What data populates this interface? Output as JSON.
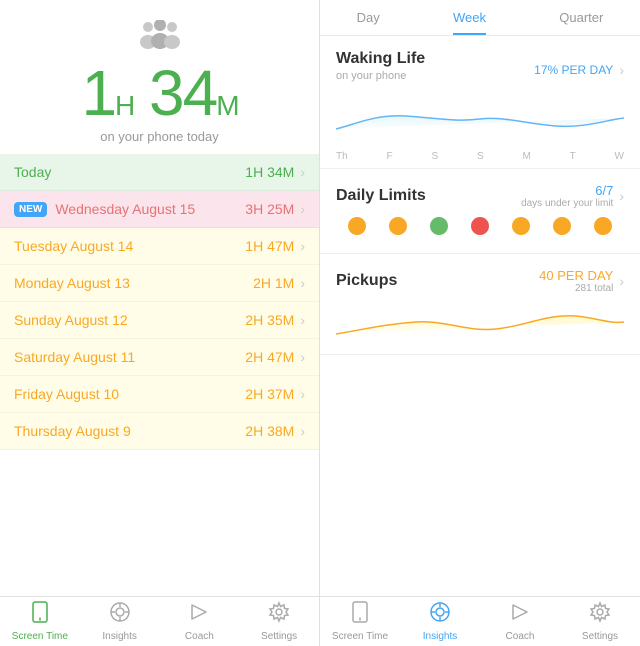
{
  "left": {
    "family_icon": "👨‍👩‍👧",
    "big_time": "1",
    "big_time_unit1": "H",
    "big_time2": "34",
    "big_time_unit2": "M",
    "subtitle": "on your phone today",
    "days": [
      {
        "label": "Today",
        "time": "1H 34M",
        "type": "today",
        "new": false
      },
      {
        "label": "Wednesday August 15",
        "time": "3H 25M",
        "type": "new",
        "new": true
      },
      {
        "label": "Tuesday August 14",
        "time": "1H 47M",
        "type": "yellow",
        "new": false
      },
      {
        "label": "Monday August 13",
        "time": "2H 1M",
        "type": "yellow",
        "new": false
      },
      {
        "label": "Sunday August 12",
        "time": "2H 35M",
        "type": "yellow",
        "new": false
      },
      {
        "label": "Saturday August 11",
        "time": "2H 47M",
        "type": "yellow",
        "new": false
      },
      {
        "label": "Friday August 10",
        "time": "2H 37M",
        "type": "yellow",
        "new": false
      },
      {
        "label": "Thursday August 9",
        "time": "2H 38M",
        "type": "yellow",
        "new": false
      }
    ],
    "new_badge_text": "NEW",
    "tabs": [
      {
        "label": "Screen Time",
        "icon": "📱",
        "active": true
      },
      {
        "label": "Insights",
        "icon": "✦",
        "active": false
      },
      {
        "label": "Coach",
        "icon": "📣",
        "active": false
      },
      {
        "label": "Settings",
        "icon": "⚙",
        "active": false
      }
    ]
  },
  "right": {
    "tabs": [
      "Day",
      "Week",
      "Quarter"
    ],
    "active_tab": "Week",
    "waking_life": {
      "title": "Waking Life",
      "value": "17% PER DAY",
      "subtitle": "on your phone",
      "chart_labels": [
        "Th",
        "F",
        "S",
        "S",
        "M",
        "T",
        "W"
      ]
    },
    "daily_limits": {
      "title": "Daily Limits",
      "value": "6/7",
      "subtitle": "days under your limit",
      "dots": [
        {
          "color": "#f9a825"
        },
        {
          "color": "#f9a825"
        },
        {
          "color": "#66bb6a"
        },
        {
          "color": "#ef5350"
        },
        {
          "color": "#f9a825"
        },
        {
          "color": "#f9a825"
        },
        {
          "color": "#f9a825"
        }
      ]
    },
    "pickups": {
      "title": "Pickups",
      "value": "40 PER DAY",
      "subtitle": "281 total"
    },
    "tabs_bar": [
      {
        "label": "Screen Time",
        "icon": "📱",
        "active": false
      },
      {
        "label": "Insights",
        "icon": "✦",
        "active": true
      },
      {
        "label": "Coach",
        "icon": "📣",
        "active": false
      },
      {
        "label": "Settings",
        "icon": "⚙",
        "active": false
      }
    ]
  }
}
